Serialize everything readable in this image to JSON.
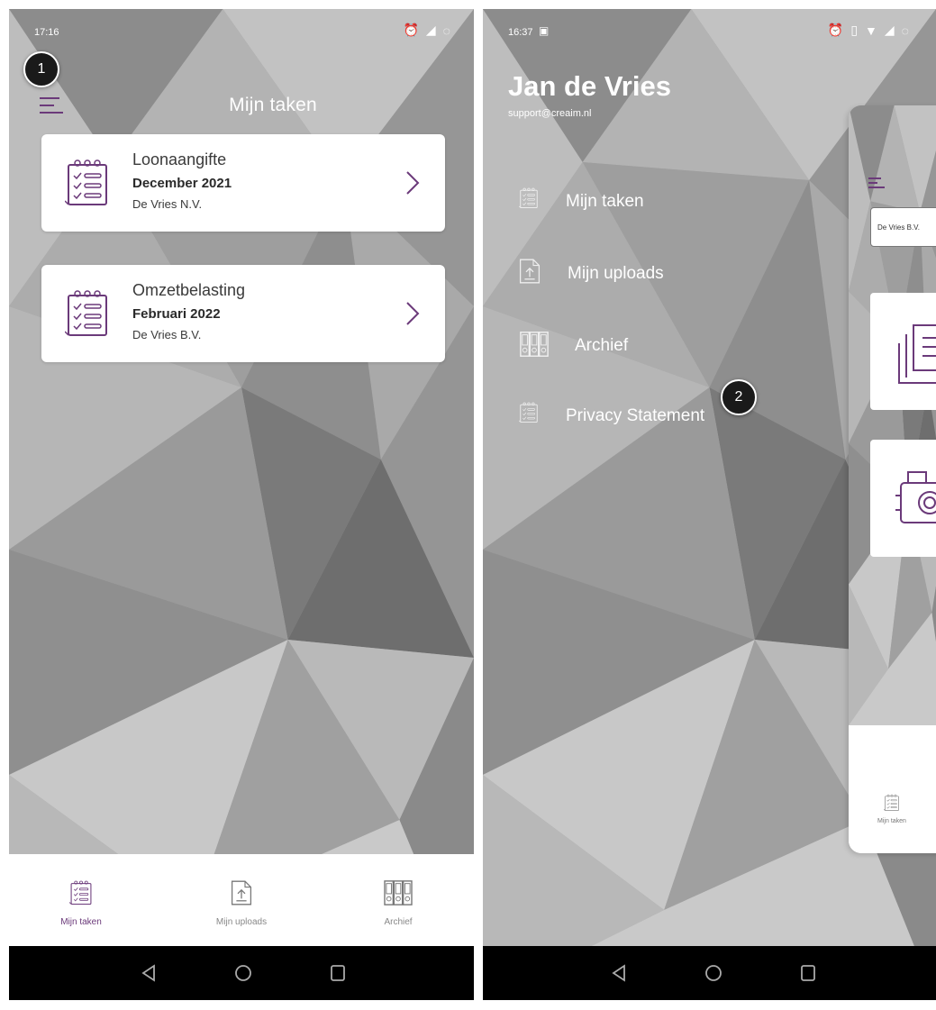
{
  "left_screen": {
    "status_time": "17:16",
    "status_icons": [
      "alarm-icon",
      "signal-icon",
      "loading-icon"
    ],
    "title": "Mijn taken",
    "tasks": [
      {
        "title": "Loonaangifte",
        "period": "December 2021",
        "company": "De Vries N.V."
      },
      {
        "title": "Omzetbelasting",
        "period": "Februari 2022",
        "company": "De Vries B.V."
      }
    ],
    "bottom_nav": [
      {
        "label": "Mijn taken",
        "icon": "clipboard-list-icon",
        "active": true
      },
      {
        "label": "Mijn uploads",
        "icon": "upload-file-icon",
        "active": false
      },
      {
        "label": "Archief",
        "icon": "archive-binders-icon",
        "active": false
      }
    ],
    "step_marker": "1"
  },
  "right_screen": {
    "status_time": "16:37",
    "status_icons": [
      "image-icon",
      "alarm-icon",
      "vibrate-icon",
      "wifi-icon",
      "signal-icon",
      "loading-icon"
    ],
    "user_name": "Jan de Vries",
    "user_email": "support@creaim.nl",
    "menu": [
      {
        "label": "Mijn taken",
        "icon": "clipboard-list-icon"
      },
      {
        "label": "Mijn uploads",
        "icon": "upload-file-icon"
      },
      {
        "label": "Archief",
        "icon": "archive-binders-icon"
      },
      {
        "label": "Privacy Statement",
        "icon": "clipboard-list-icon"
      }
    ],
    "preview": {
      "company_select": "De Vries B.V.",
      "bottom_label": "Mijn taken"
    },
    "step_marker": "2"
  },
  "colors": {
    "accent": "#6b3a7a",
    "background_gray": "#a8a8a8",
    "card_white": "#ffffff",
    "system_nav": "#000000"
  }
}
